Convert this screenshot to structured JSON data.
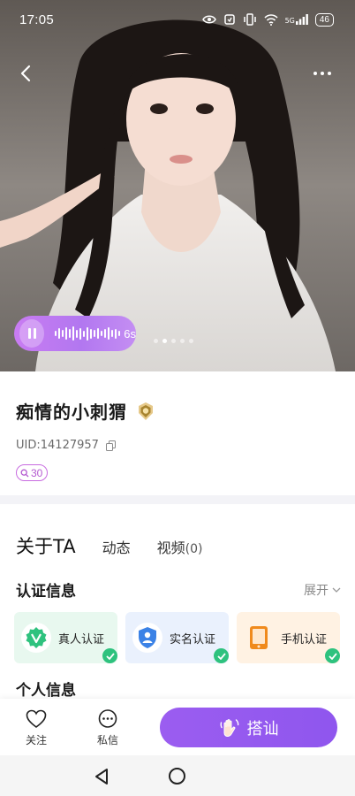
{
  "status_bar": {
    "time": "17:05",
    "network": "5G",
    "battery": "46"
  },
  "hero": {
    "voice_duration": "6s",
    "photo_count": 5,
    "active_photo_index": 1
  },
  "profile": {
    "name": "痴情的小刺猬",
    "uid_label": "UID: ",
    "uid": "14127957",
    "level": "30"
  },
  "tabs": {
    "about": "关于TA",
    "moments": "动态",
    "videos": "视频",
    "videos_count": "(0)"
  },
  "certification": {
    "title": "认证信息",
    "expand_label": "展开",
    "items": [
      {
        "label": "真人认证",
        "icon": "verified-v-icon",
        "color": "#2ec27e"
      },
      {
        "label": "实名认证",
        "icon": "id-person-shield-icon",
        "color": "#3b82e6"
      },
      {
        "label": "手机认证",
        "icon": "phone-icon",
        "color": "#f08a1c"
      }
    ]
  },
  "personal_info": {
    "title": "个人信息"
  },
  "action_bar": {
    "follow_label": "关注",
    "chat_label": "私信",
    "greet_label": "搭讪"
  },
  "colors": {
    "accent_purple": "#9b5df0",
    "level_tag": "#c86be0",
    "check_green": "#2ec27e"
  }
}
